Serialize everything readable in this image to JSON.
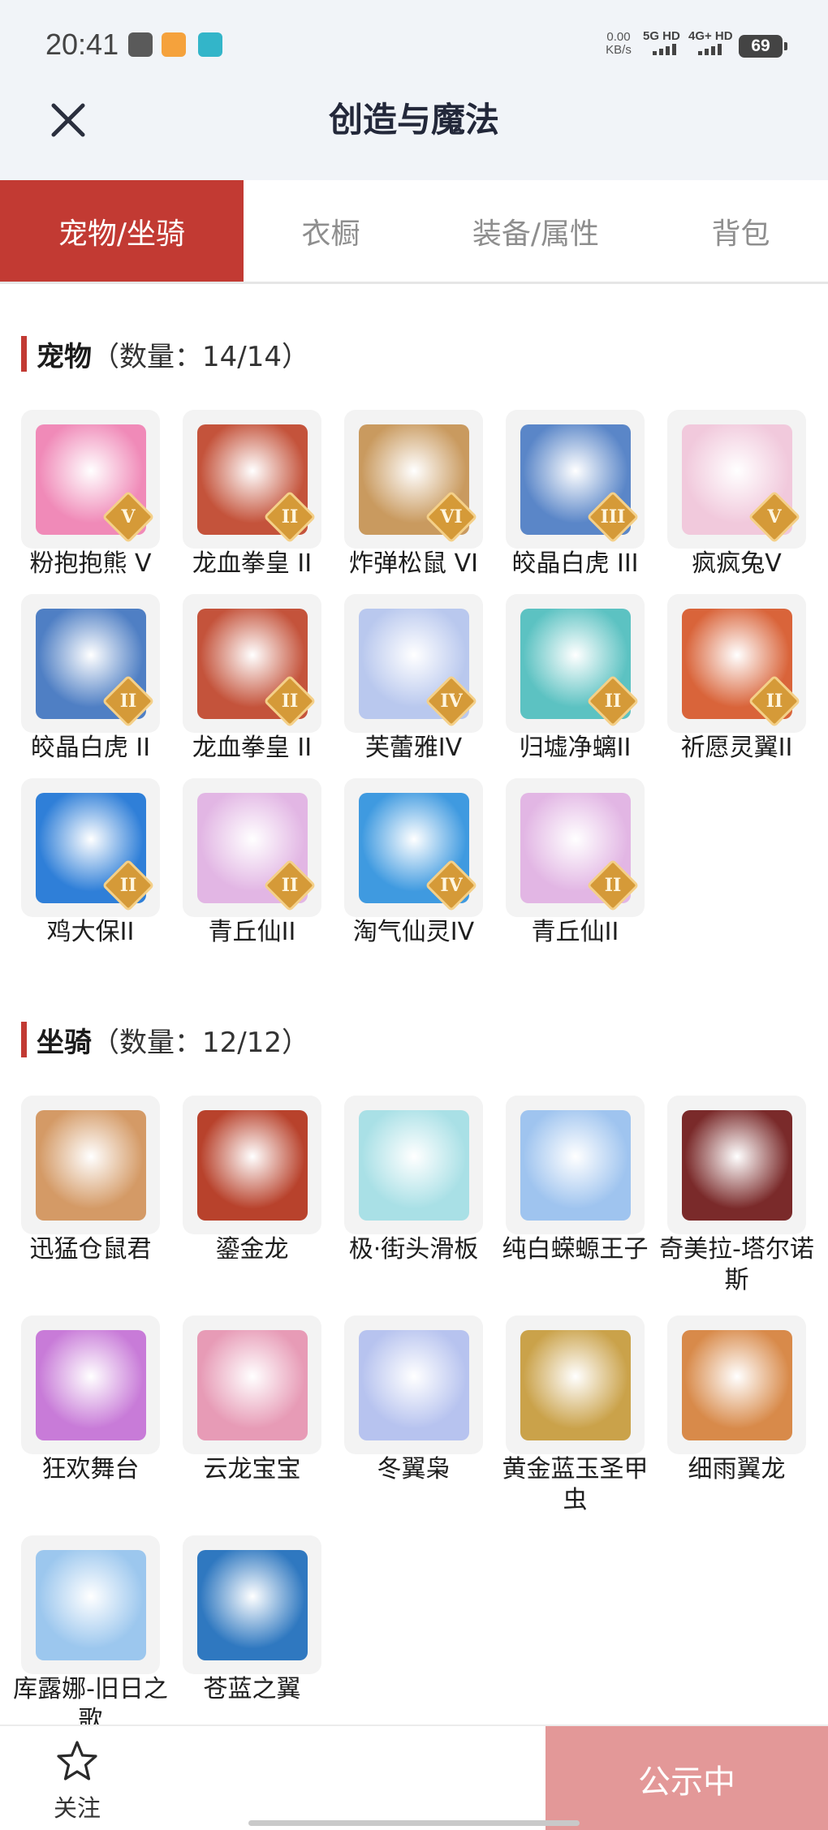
{
  "status_bar": {
    "time": "20:41",
    "net_speed_value": "0.00",
    "net_speed_unit": "KB/s",
    "signal_1_label": "5G HD",
    "signal_2_label": "4G+ HD",
    "battery": "69"
  },
  "header": {
    "title": "创造与魔法"
  },
  "tabs": [
    {
      "label": "宠物/坐骑",
      "active": true
    },
    {
      "label": "衣橱",
      "active": false
    },
    {
      "label": "装备/属性",
      "active": false
    },
    {
      "label": "背包",
      "active": false
    }
  ],
  "pets": {
    "title": "宠物",
    "count": "（数量：14/14）",
    "items": [
      {
        "name": "粉抱抱熊 V",
        "badge": "V",
        "icon": "pink-bear",
        "color": "#f08ab8"
      },
      {
        "name": "龙血拳皇 II",
        "badge": "II",
        "icon": "red-dragon-fighter",
        "color": "#c4533b"
      },
      {
        "name": "炸弹松鼠 VI",
        "badge": "VI",
        "icon": "bomb-squirrel",
        "color": "#c99a5f"
      },
      {
        "name": "皎晶白虎 III",
        "badge": "III",
        "icon": "crystal-white-tiger",
        "color": "#5a86c8"
      },
      {
        "name": "疯疯兔V",
        "badge": "V",
        "icon": "crazy-rabbit",
        "color": "#f1c9dc"
      },
      {
        "name": "皎晶白虎 II",
        "badge": "II",
        "icon": "crystal-white-tiger",
        "color": "#4f7fc4"
      },
      {
        "name": "龙血拳皇 II",
        "badge": "II",
        "icon": "red-dragon-fighter",
        "color": "#c4533b"
      },
      {
        "name": "芙蕾雅IV",
        "badge": "IV",
        "icon": "freya",
        "color": "#b9c8ee"
      },
      {
        "name": "归墟净螭II",
        "badge": "II",
        "icon": "sea-dragon",
        "color": "#5cc2c2"
      },
      {
        "name": "祈愿灵翼II",
        "badge": "II",
        "icon": "wish-wing-bird",
        "color": "#d9643a"
      },
      {
        "name": "鸡大保II",
        "badge": "II",
        "icon": "blue-chicken",
        "color": "#2f7fd8"
      },
      {
        "name": "青丘仙II",
        "badge": "II",
        "icon": "fox-fairy",
        "color": "#e2b6e4"
      },
      {
        "name": "淘气仙灵IV",
        "badge": "IV",
        "icon": "blue-puppy",
        "color": "#3f9ae0"
      },
      {
        "name": "青丘仙II",
        "badge": "II",
        "icon": "fox-fairy",
        "color": "#e2b6e4"
      }
    ]
  },
  "mounts": {
    "title": "坐骑",
    "count": "（数量：12/12）",
    "items": [
      {
        "name": "迅猛仓鼠君",
        "icon": "hamster-pilot",
        "color": "#d49a66"
      },
      {
        "name": "鎏金龙",
        "icon": "golden-dragon",
        "color": "#b8422c"
      },
      {
        "name": "极·街头滑板",
        "icon": "skateboard",
        "color": "#a9e0e6"
      },
      {
        "name": "纯白蝾螈王子",
        "icon": "white-axolotl",
        "color": "#9fc4ef"
      },
      {
        "name": "奇美拉-塔尔诺斯",
        "icon": "chimera",
        "color": "#7a2a2a"
      },
      {
        "name": "狂欢舞台",
        "icon": "carnival-stage",
        "color": "#c87bd8"
      },
      {
        "name": "云龙宝宝",
        "icon": "cloud-dragon-baby",
        "color": "#e79bb6"
      },
      {
        "name": "冬翼枭",
        "icon": "winter-owl",
        "color": "#b7c3ef"
      },
      {
        "name": "黄金蓝玉圣甲虫",
        "icon": "golden-scarab",
        "color": "#caa24a"
      },
      {
        "name": "细雨翼龙",
        "icon": "rain-pterosaur",
        "color": "#d88a4a"
      },
      {
        "name": "库露娜-旧日之歌",
        "icon": "curly-hair-girl",
        "color": "#9cc7ee"
      },
      {
        "name": "苍蓝之翼",
        "icon": "azure-wing-dragon",
        "color": "#2f78c0"
      }
    ]
  },
  "bottom_bar": {
    "follow_label": "关注",
    "publish_label": "公示中"
  },
  "colors": {
    "accent": "#c23a33",
    "publish_button": "#e39898",
    "header_bg": "#f1f4f8"
  }
}
